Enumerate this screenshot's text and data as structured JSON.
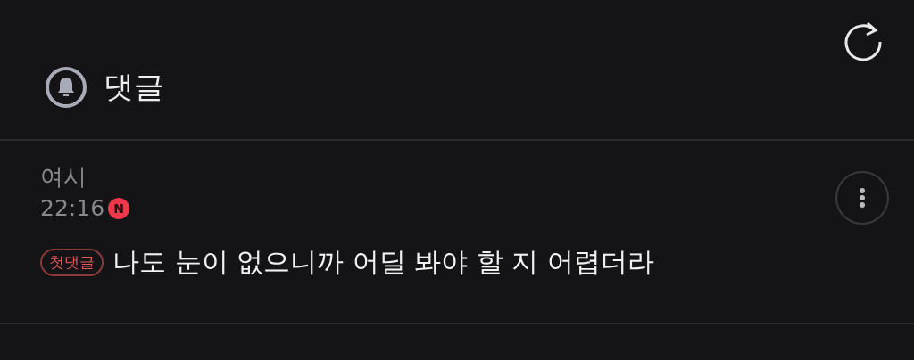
{
  "header": {
    "title": "댓글"
  },
  "comments": [
    {
      "author": "여시",
      "time": "22:16",
      "new_badge": "N",
      "tag": "첫댓글",
      "text": "나도 눈이 없으니까 어딜 봐야 할 지 어렵더라"
    }
  ]
}
